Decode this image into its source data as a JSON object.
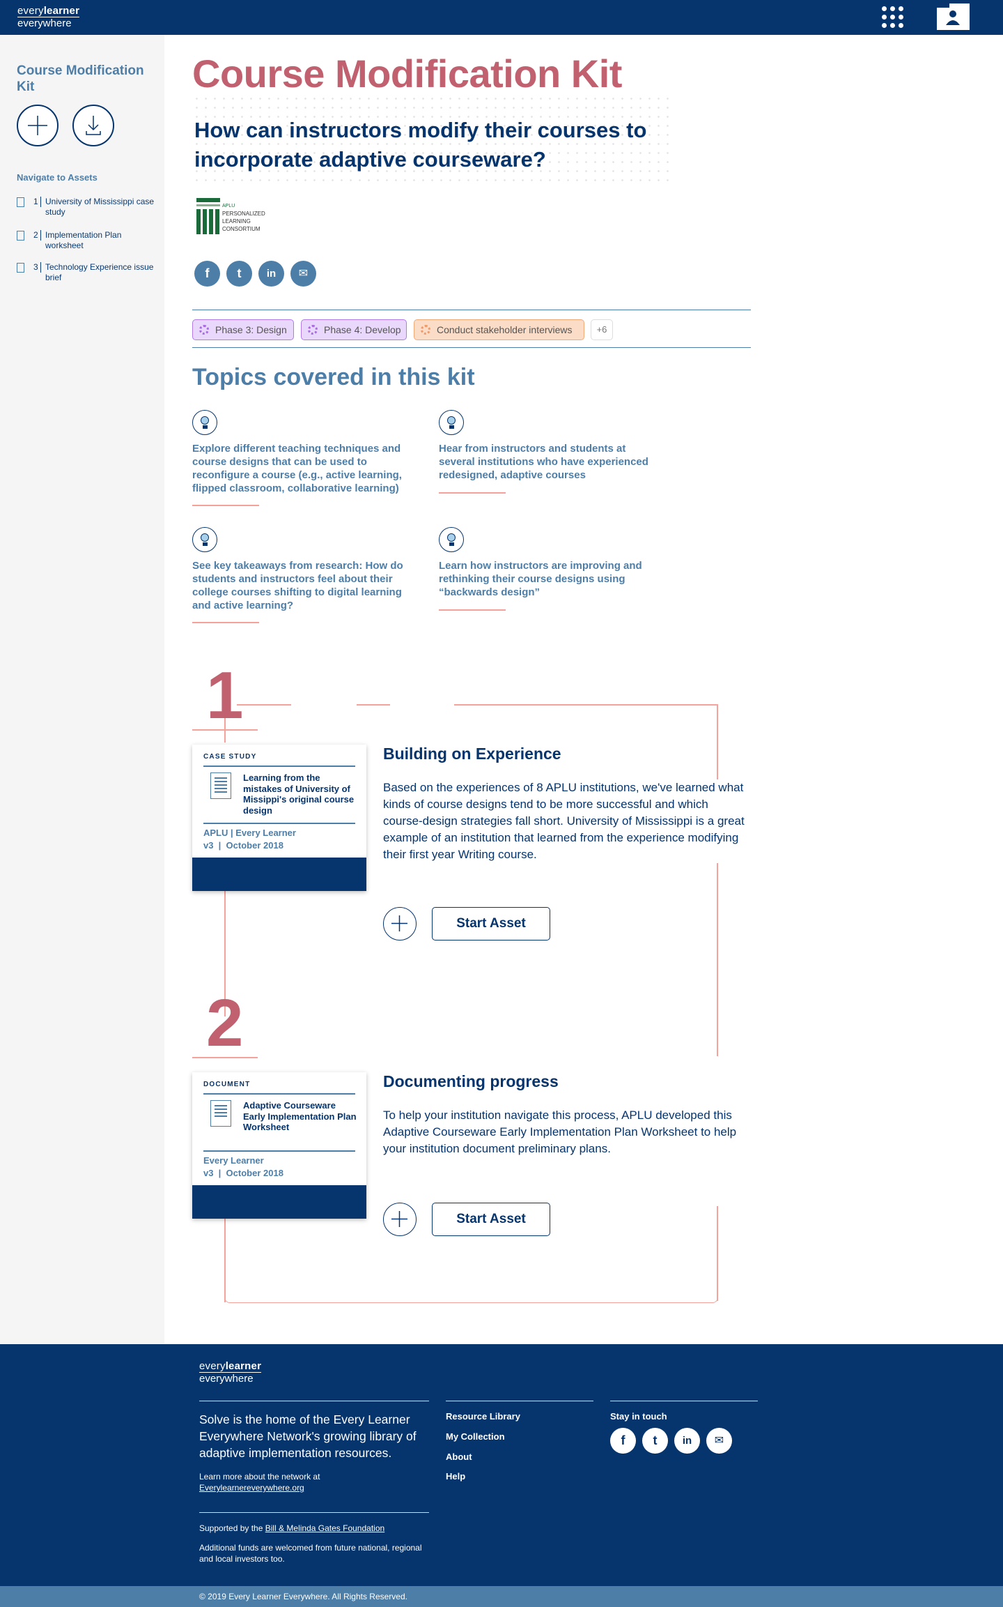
{
  "brand": {
    "logo_line1_a": "every",
    "logo_line1_b": "learner",
    "logo_line2": "everywhere"
  },
  "icons": {
    "apps": "apps-grid-icon",
    "profile": "profile-card-icon",
    "add": "plus-icon",
    "download": "download-icon",
    "doc": "document-icon",
    "bulb": "lightbulb-icon",
    "gear": "gear-icon"
  },
  "colors": {
    "navy": "#06346c",
    "rose": "#c1606f",
    "steel": "#4d7ea8",
    "salmon": "#f4a29a",
    "purple_tag": "#e9d8fb",
    "orange_tag": "#fbdcc6"
  },
  "sidebar": {
    "title": "Course Modification Kit",
    "nav_title": "Navigate to Assets",
    "items": [
      {
        "num": "1",
        "label": "University of Mississippi case study"
      },
      {
        "num": "2",
        "label": "Implementation Plan worksheet"
      },
      {
        "num": "3",
        "label": "Technology Experience issue brief"
      }
    ]
  },
  "main": {
    "title": "Course Modification Kit",
    "question": "How can instructors modify their courses to incorporate adaptive courseware?",
    "partner": {
      "line1": "APLU",
      "line2": "Personalized",
      "line3": "Learning",
      "line4": "Consortium"
    },
    "social": [
      "f",
      "t",
      "in",
      "✉"
    ],
    "tags": [
      "Phase 3: Design",
      "Phase 4: Develop",
      "Conduct stakeholder interviews"
    ],
    "tags_more": "+6",
    "topics_title": "Topics covered in this kit",
    "topics": [
      "Explore different teaching techniques and course designs that can be used to reconfigure a course (e.g., active learning, flipped classroom, collaborative learning)",
      "Hear from instructors and students at several institutions who have experienced redesigned, adaptive courses",
      "See key takeaways from research: How do students and instructors feel about their college courses shifting to digital learning and active learning?",
      "Learn how instructors are improving and rethinking their course designs using “backwards design”"
    ],
    "steps": [
      {
        "num": "1",
        "card_type": "CASE STUDY",
        "card_title": "Learning from the mistakes of University of Missippi's original course design",
        "card_source": "APLU | Every Learner",
        "card_version": "v3  |  October 2018",
        "title": "Building on Experience",
        "desc": "Based on the experiences of 8 APLU institutions, we've learned what kinds of course designs tend to be more successful and which course-design strategies fall short. University of Mississippi is a great example of an institution that learned from the experience modifying their first year Writing course.",
        "button": "Start Asset"
      },
      {
        "num": "2",
        "card_type": "DOCUMENT",
        "card_title": "Adaptive Courseware Early Implementation Plan Worksheet",
        "card_source": "Every Learner",
        "card_version": "v3  |  October 2018",
        "title": "Documenting progress",
        "desc": "To help your institution navigate this process, APLU developed this Adaptive Courseware Early Implementation Plan Worksheet to help your institution document preliminary plans.",
        "button": "Start Asset"
      }
    ]
  },
  "footer": {
    "tagline": "Solve is the home of the Every Learner Everywhere Network's growing library of adaptive implementation resources.",
    "learn_more": "Learn more about the network at",
    "learn_link": "Everylearnereverywhere.org",
    "supported_by": "Supported by the",
    "supporter_link": "Bill & Melinda Gates Foundation",
    "additional": "Additional funds are welcomed from future national, regional and local investors too.",
    "links": [
      "Resource Library",
      "My Collection",
      "About",
      "Help"
    ],
    "stay_title": "Stay in touch",
    "social": [
      "f",
      "t",
      "in",
      "✉"
    ],
    "copyright": "© 2019 Every Learner Everywhere. All Rights Reserved."
  }
}
